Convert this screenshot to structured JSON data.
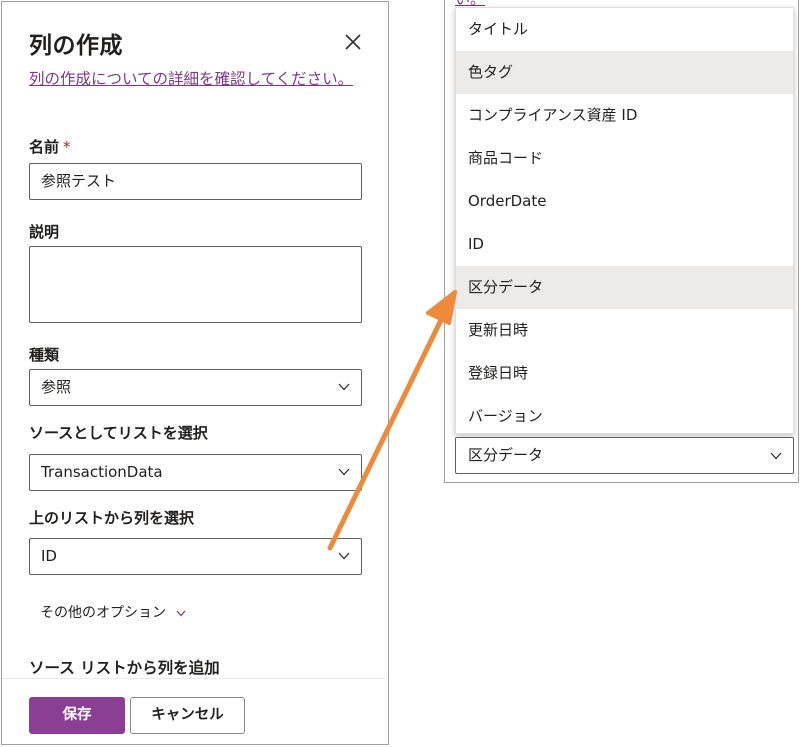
{
  "left_panel": {
    "title": "列の作成",
    "learn_link": "列の作成についての詳細を確認してください。",
    "name_label": "名前",
    "required_mark": "*",
    "name_value": "参照テスト",
    "description_label": "説明",
    "description_value": "",
    "type_label": "種類",
    "type_value": "参照",
    "source_list_label": "ソースとしてリストを選択",
    "source_list_value": "TransactionData",
    "column_label": "上のリストから列を選択",
    "column_value": "ID",
    "more_options": "その他のオプション",
    "add_from_source": "ソース リストから列を追加",
    "save_label": "保存",
    "cancel_label": "キャンセル"
  },
  "right_panel": {
    "cut_link_text": "い。",
    "menu_items": [
      "タイトル",
      "色タグ",
      "コンプライアンス資産 ID",
      "商品コード",
      "OrderDate",
      "ID",
      "区分データ",
      "更新日時",
      "登録日時",
      "バージョン"
    ],
    "highlighted_items": [
      "色タグ",
      "区分データ"
    ],
    "selected_value": "区分データ"
  },
  "colors": {
    "accent": "#8a3f94",
    "link": "#7d3a86",
    "arrow": "#ed8a3b",
    "required": "#a4262c",
    "menu_highlight": "#edebe9"
  },
  "icons": [
    "close-icon",
    "chevron-down-icon",
    "arrow-annotation"
  ]
}
